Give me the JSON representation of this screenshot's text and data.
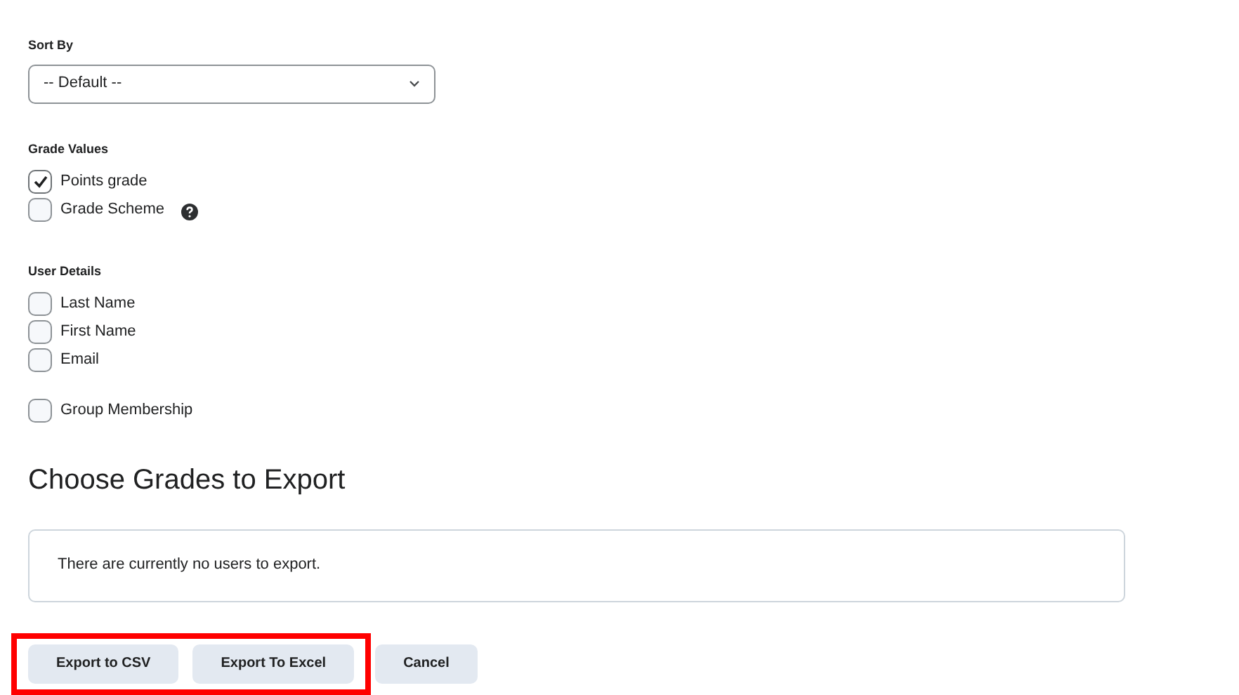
{
  "sort_by": {
    "label": "Sort By",
    "value": "-- Default --"
  },
  "grade_values": {
    "label": "Grade Values",
    "options": [
      {
        "label": "Points grade",
        "checked": true,
        "help": false
      },
      {
        "label": "Grade Scheme",
        "checked": false,
        "help": true
      }
    ]
  },
  "user_details": {
    "label": "User Details",
    "options": [
      {
        "label": "Last Name",
        "checked": false
      },
      {
        "label": "First Name",
        "checked": false
      },
      {
        "label": "Email",
        "checked": false
      }
    ]
  },
  "group_membership": {
    "label": "Group Membership",
    "checked": false
  },
  "section_title": "Choose Grades to Export",
  "empty_message": "There are currently no users to export.",
  "buttons": [
    {
      "label": "Export to CSV",
      "highlighted": true
    },
    {
      "label": "Export To Excel",
      "highlighted": true
    },
    {
      "label": "Cancel",
      "highlighted": false
    }
  ]
}
